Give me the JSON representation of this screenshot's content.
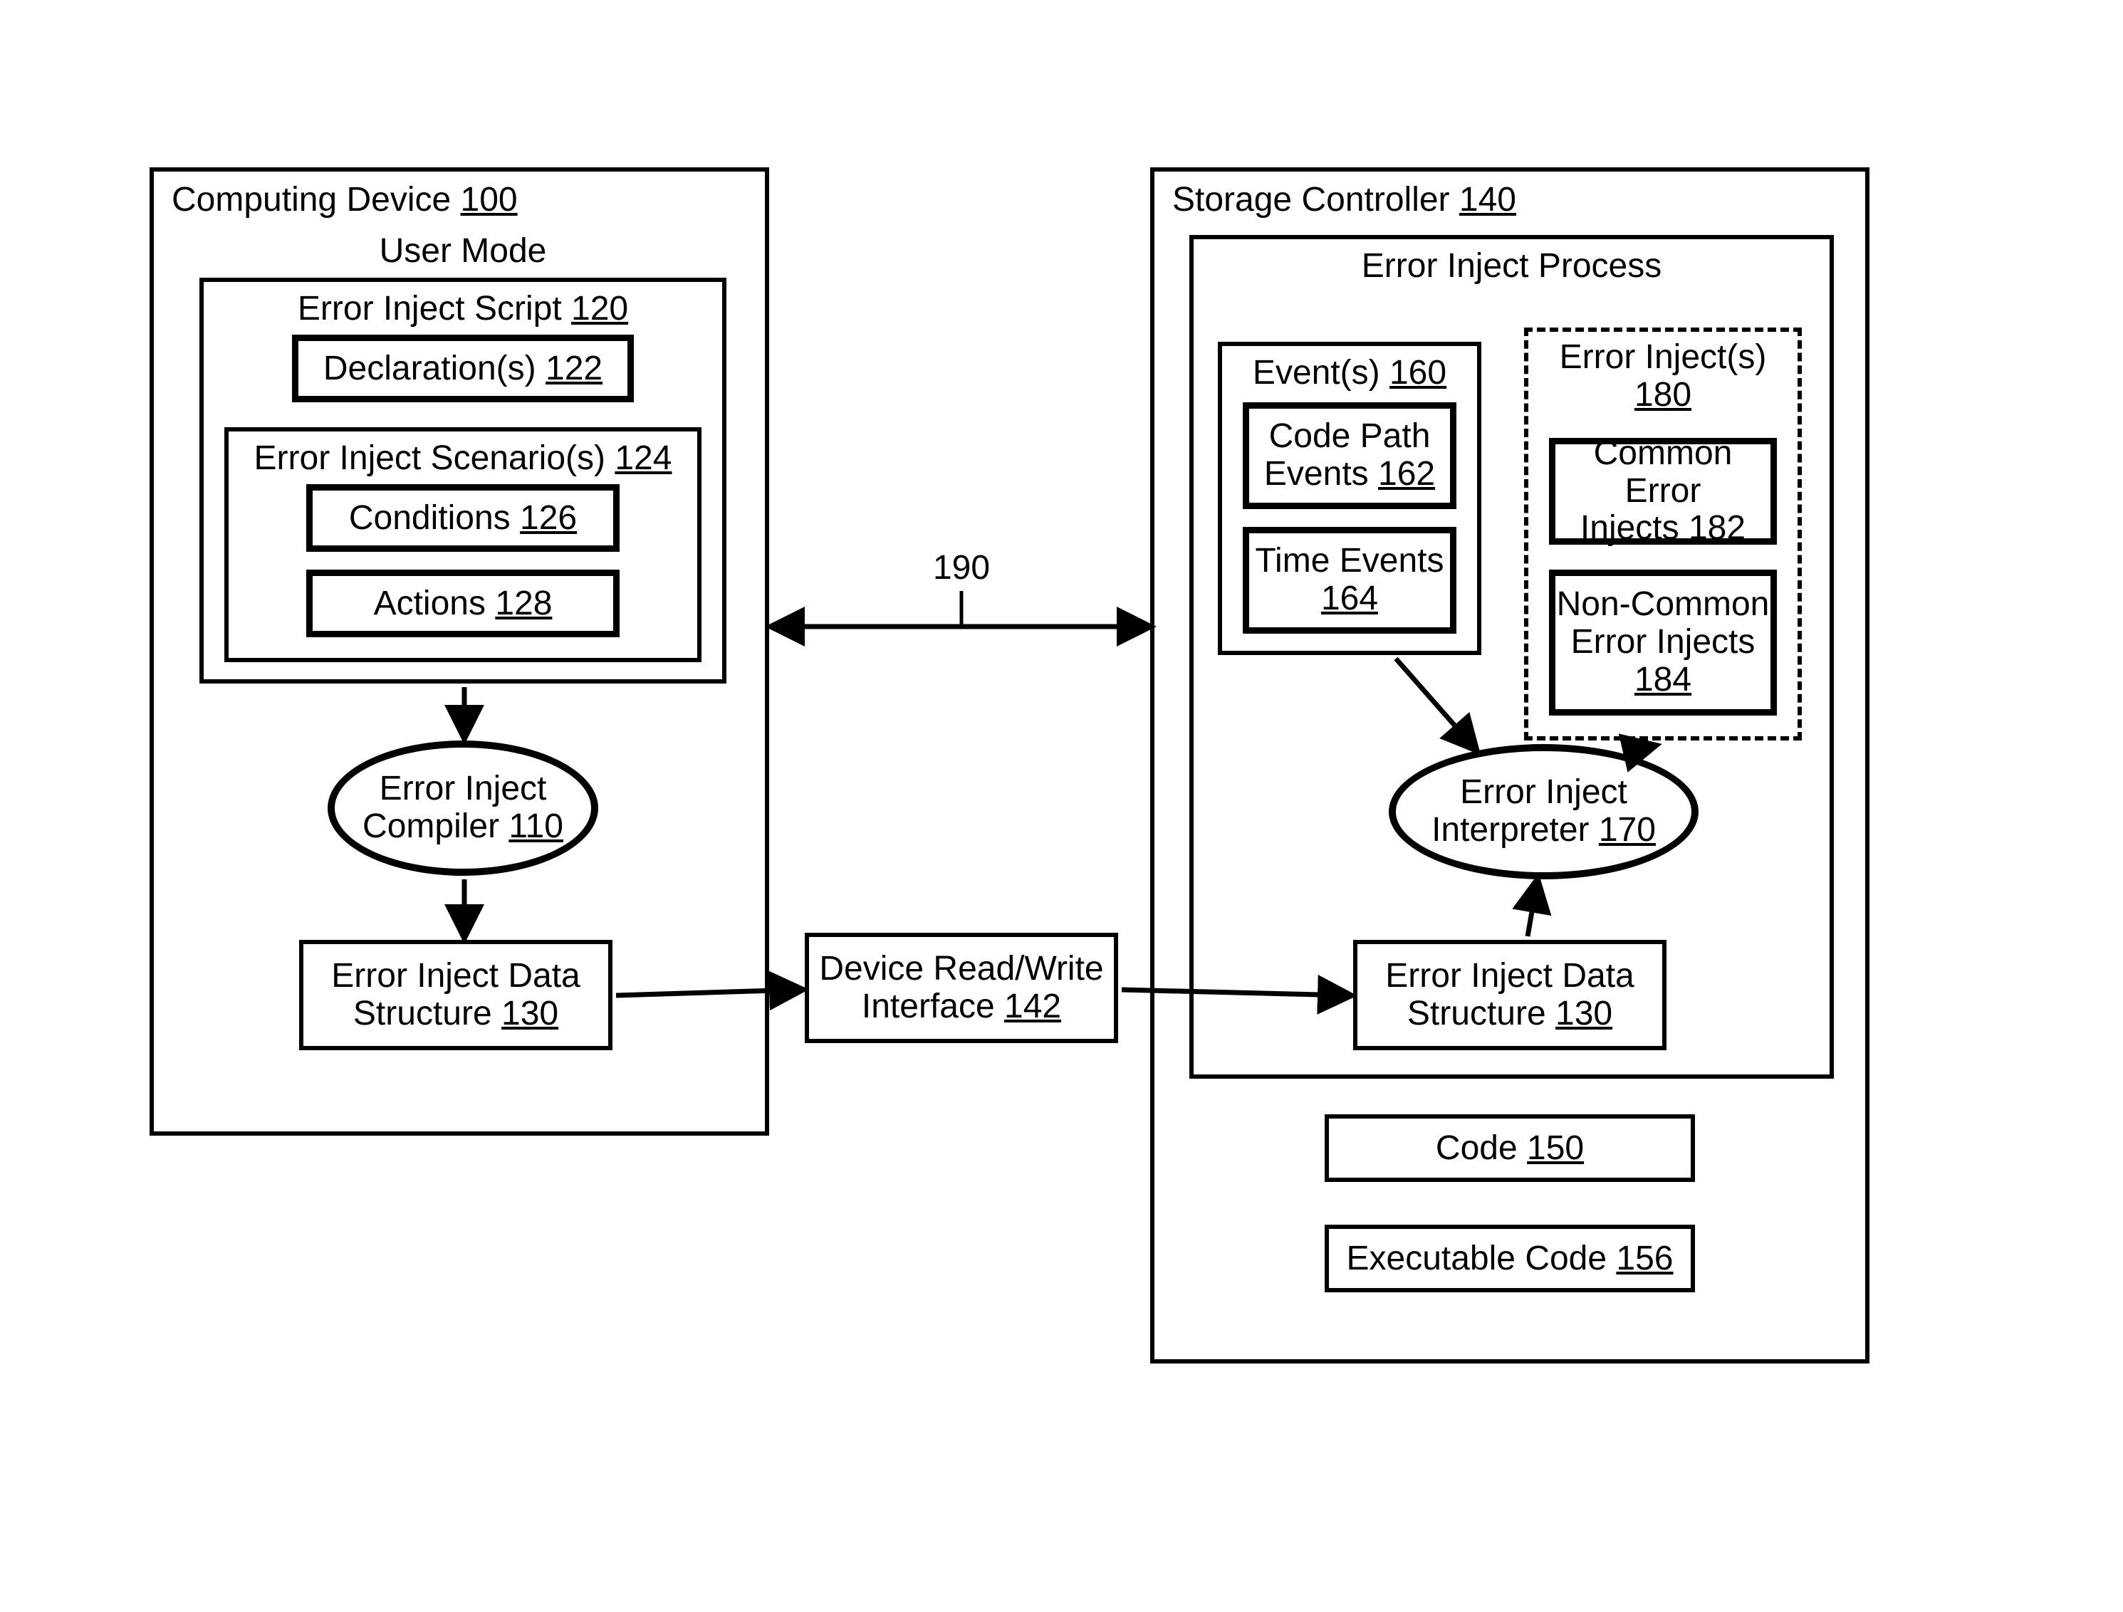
{
  "computing_device": {
    "label": "Computing Device",
    "num": "100"
  },
  "user_mode": {
    "label": "User Mode"
  },
  "error_inject_script": {
    "label": "Error Inject Script",
    "num": "120"
  },
  "declarations": {
    "label": "Declaration(s)",
    "num": "122"
  },
  "scenarios": {
    "label": "Error Inject Scenario(s)",
    "num": "124"
  },
  "conditions": {
    "label": "Conditions",
    "num": "126"
  },
  "actions": {
    "label": "Actions",
    "num": "128"
  },
  "compiler": {
    "label": "Error Inject",
    "label2": "Compiler",
    "num": "110"
  },
  "data_structure_left": {
    "label1": "Error Inject Data",
    "label2": "Structure",
    "num": "130"
  },
  "device_rw": {
    "label1": "Device Read/Write",
    "label2": "Interface",
    "num": "142"
  },
  "connection_190": {
    "num": "190"
  },
  "storage_controller": {
    "label": "Storage Controller",
    "num": "140"
  },
  "error_inject_process": {
    "label": "Error Inject Process"
  },
  "events": {
    "label": "Event(s)",
    "num": "160"
  },
  "code_path_events": {
    "label1": "Code Path",
    "label2": "Events",
    "num": "162"
  },
  "time_events": {
    "label1": "Time Events",
    "num": "164"
  },
  "error_injects": {
    "label": "Error Inject(s)",
    "num": "180"
  },
  "common_injects": {
    "label1": "Common Error",
    "label2": "Injects",
    "num": "182"
  },
  "noncommon_injects": {
    "label1": "Non-Common",
    "label2": "Error Injects",
    "num": "184"
  },
  "interpreter": {
    "label1": "Error Inject",
    "label2": "Interpreter",
    "num": "170"
  },
  "data_structure_right": {
    "label1": "Error Inject Data",
    "label2": "Structure",
    "num": "130"
  },
  "code": {
    "label": "Code",
    "num": "150"
  },
  "executable_code": {
    "label": "Executable Code",
    "num": "156"
  }
}
